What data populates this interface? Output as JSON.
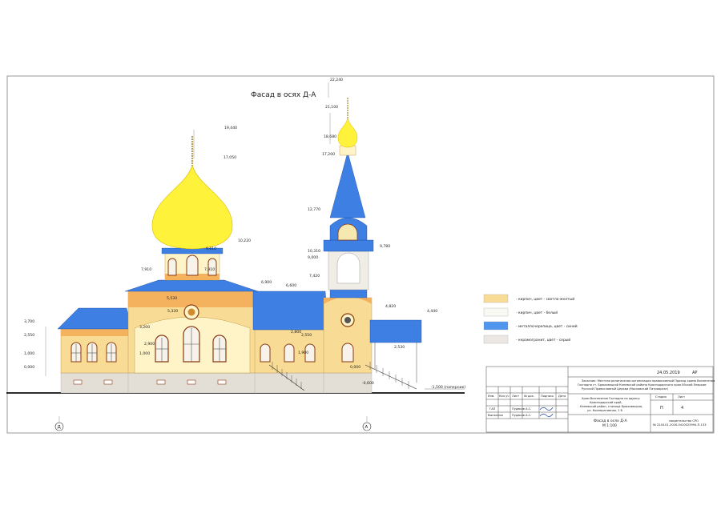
{
  "drawing": {
    "title": "Фасад в осях Д-А",
    "axis_left": "Д",
    "axis_right": "А",
    "colors": {
      "beige": "#f8dc95",
      "cream": "#fff4c8",
      "blue": "#3d7fe3",
      "gold": "#fff23a",
      "stone": "#e3ded6",
      "orange": "#f4b25e"
    },
    "levels": {
      "l22240": "22,240",
      "l21100": "21,100",
      "l19440": "19,440",
      "l18680": "18,680",
      "l17200": "17,200",
      "l17050": "17,050",
      "l12770": "12,770",
      "l10220": "10,220",
      "l10310": "10,310",
      "l9610": "9,610",
      "l9000": "9,000",
      "l7910l": "7,910",
      "l7910": "7,910",
      "l7420": "7,420",
      "l6900": "6,900",
      "l6600": "6,600",
      "l5530": "5,530",
      "l5330": "5,330",
      "l4820": "4,820",
      "l4440": "4,440",
      "l3700": "3,700",
      "l3200": "3,200",
      "l2900": "2,900",
      "l2800": "2,800",
      "l2550": "2,550",
      "l2550r": "2,550",
      "l2530": "2,530",
      "l1900": "1,900",
      "l1000": "1,000",
      "l1000b": "1,000",
      "l0000": "0,000",
      "l0000r": "0,000",
      "lm600": "-0,600",
      "lm1500": "-1,500 (паперник)"
    }
  },
  "legend": [
    {
      "swatch": "#f8dc95",
      "label": "- кирпич, цвет - светло-желтый"
    },
    {
      "swatch": "#f9f9f4",
      "label": "- кирпич, цвет - белый"
    },
    {
      "swatch": "#4f95ee",
      "label": "- металлочерепица, цвет - синий"
    },
    {
      "swatch": "#ece7e3",
      "label": "- керамогранит, цвет - серый"
    }
  ],
  "title_block": {
    "date": "24.05.2019",
    "sheet_code": "АР",
    "description": [
      "Заказчик: Местная религиозная организация православный Приход храма Вознесения",
      "Господня ст. Брюховецкой Каневской района Краснодарского края Ейской Епархии",
      "Русской Православной Церкви (Московский Патриархат)"
    ],
    "project_name": [
      "Храм Вознесения Господня по адресу:",
      "Краснодарский край,",
      "Каневской район, станица Брюховецкая,",
      "ул. Кооперативная, 1 б"
    ],
    "headers": {
      "stage": "Стадия",
      "sheet": "Лист",
      "stage_val": "П",
      "sheet_val": "4"
    },
    "cols": [
      "Изм.",
      "Кол.уч",
      "Лист",
      "№ док.",
      "Подпись",
      "Дата"
    ],
    "roles": [
      {
        "role": "ГАП",
        "name": "Пудвков А.С."
      },
      {
        "role": "Выполнил",
        "name": "Пудвков А.С."
      }
    ],
    "sheet_title": [
      "Фасад в осях Д-А",
      "М 1:100"
    ],
    "cert": [
      "свидетельство СРО",
      "№ 2244.01-2016-0410025994-П-133"
    ]
  }
}
